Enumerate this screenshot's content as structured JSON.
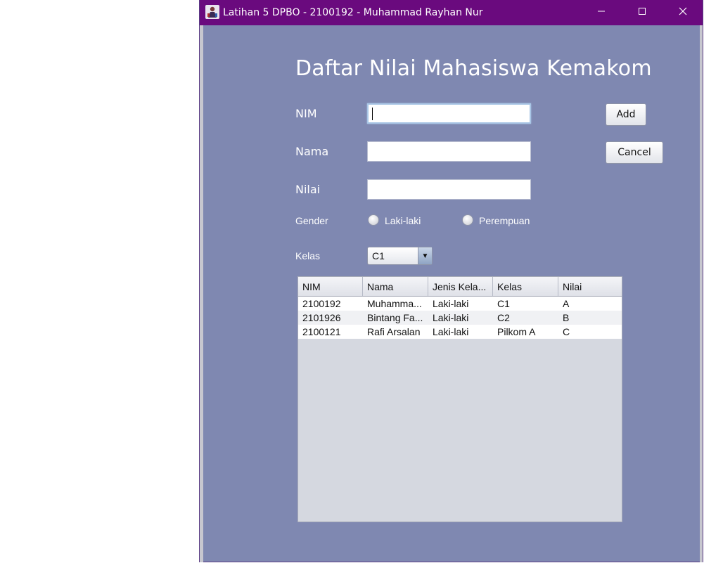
{
  "window": {
    "title": "Latihan 5 DPBO - 2100192 - Muhammad Rayhan Nur",
    "icon": "java-app-icon",
    "controls": [
      "minimize-icon",
      "maximize-icon",
      "close-icon"
    ]
  },
  "form": {
    "heading": "Daftar Nilai Mahasiswa Kemakom",
    "nim_label": "NIM",
    "nim_value": "",
    "nama_label": "Nama",
    "nama_value": "",
    "nilai_label": "Nilai",
    "nilai_value": "",
    "gender_label": "Gender",
    "gender_options": [
      "Laki-laki",
      "Perempuan"
    ],
    "kelas_label": "Kelas",
    "kelas_selected": "C1",
    "add_label": "Add",
    "cancel_label": "Cancel"
  },
  "table": {
    "columns": [
      "NIM",
      "Nama",
      "Jenis Kela...",
      "Kelas",
      "Nilai"
    ],
    "rows": [
      [
        "2100192",
        "Muhamma...",
        "Laki-laki",
        "C1",
        "A"
      ],
      [
        "2101926",
        "Bintang Fa...",
        "Laki-laki",
        "C2",
        "B"
      ],
      [
        "2100121",
        "Rafi Arsalan",
        "Laki-laki",
        "Pilkom A",
        "C"
      ]
    ]
  },
  "colors": {
    "titlebar": "#6a0a7e",
    "window_bg": "#7f88b1",
    "table_bg": "#d5d8e0"
  }
}
